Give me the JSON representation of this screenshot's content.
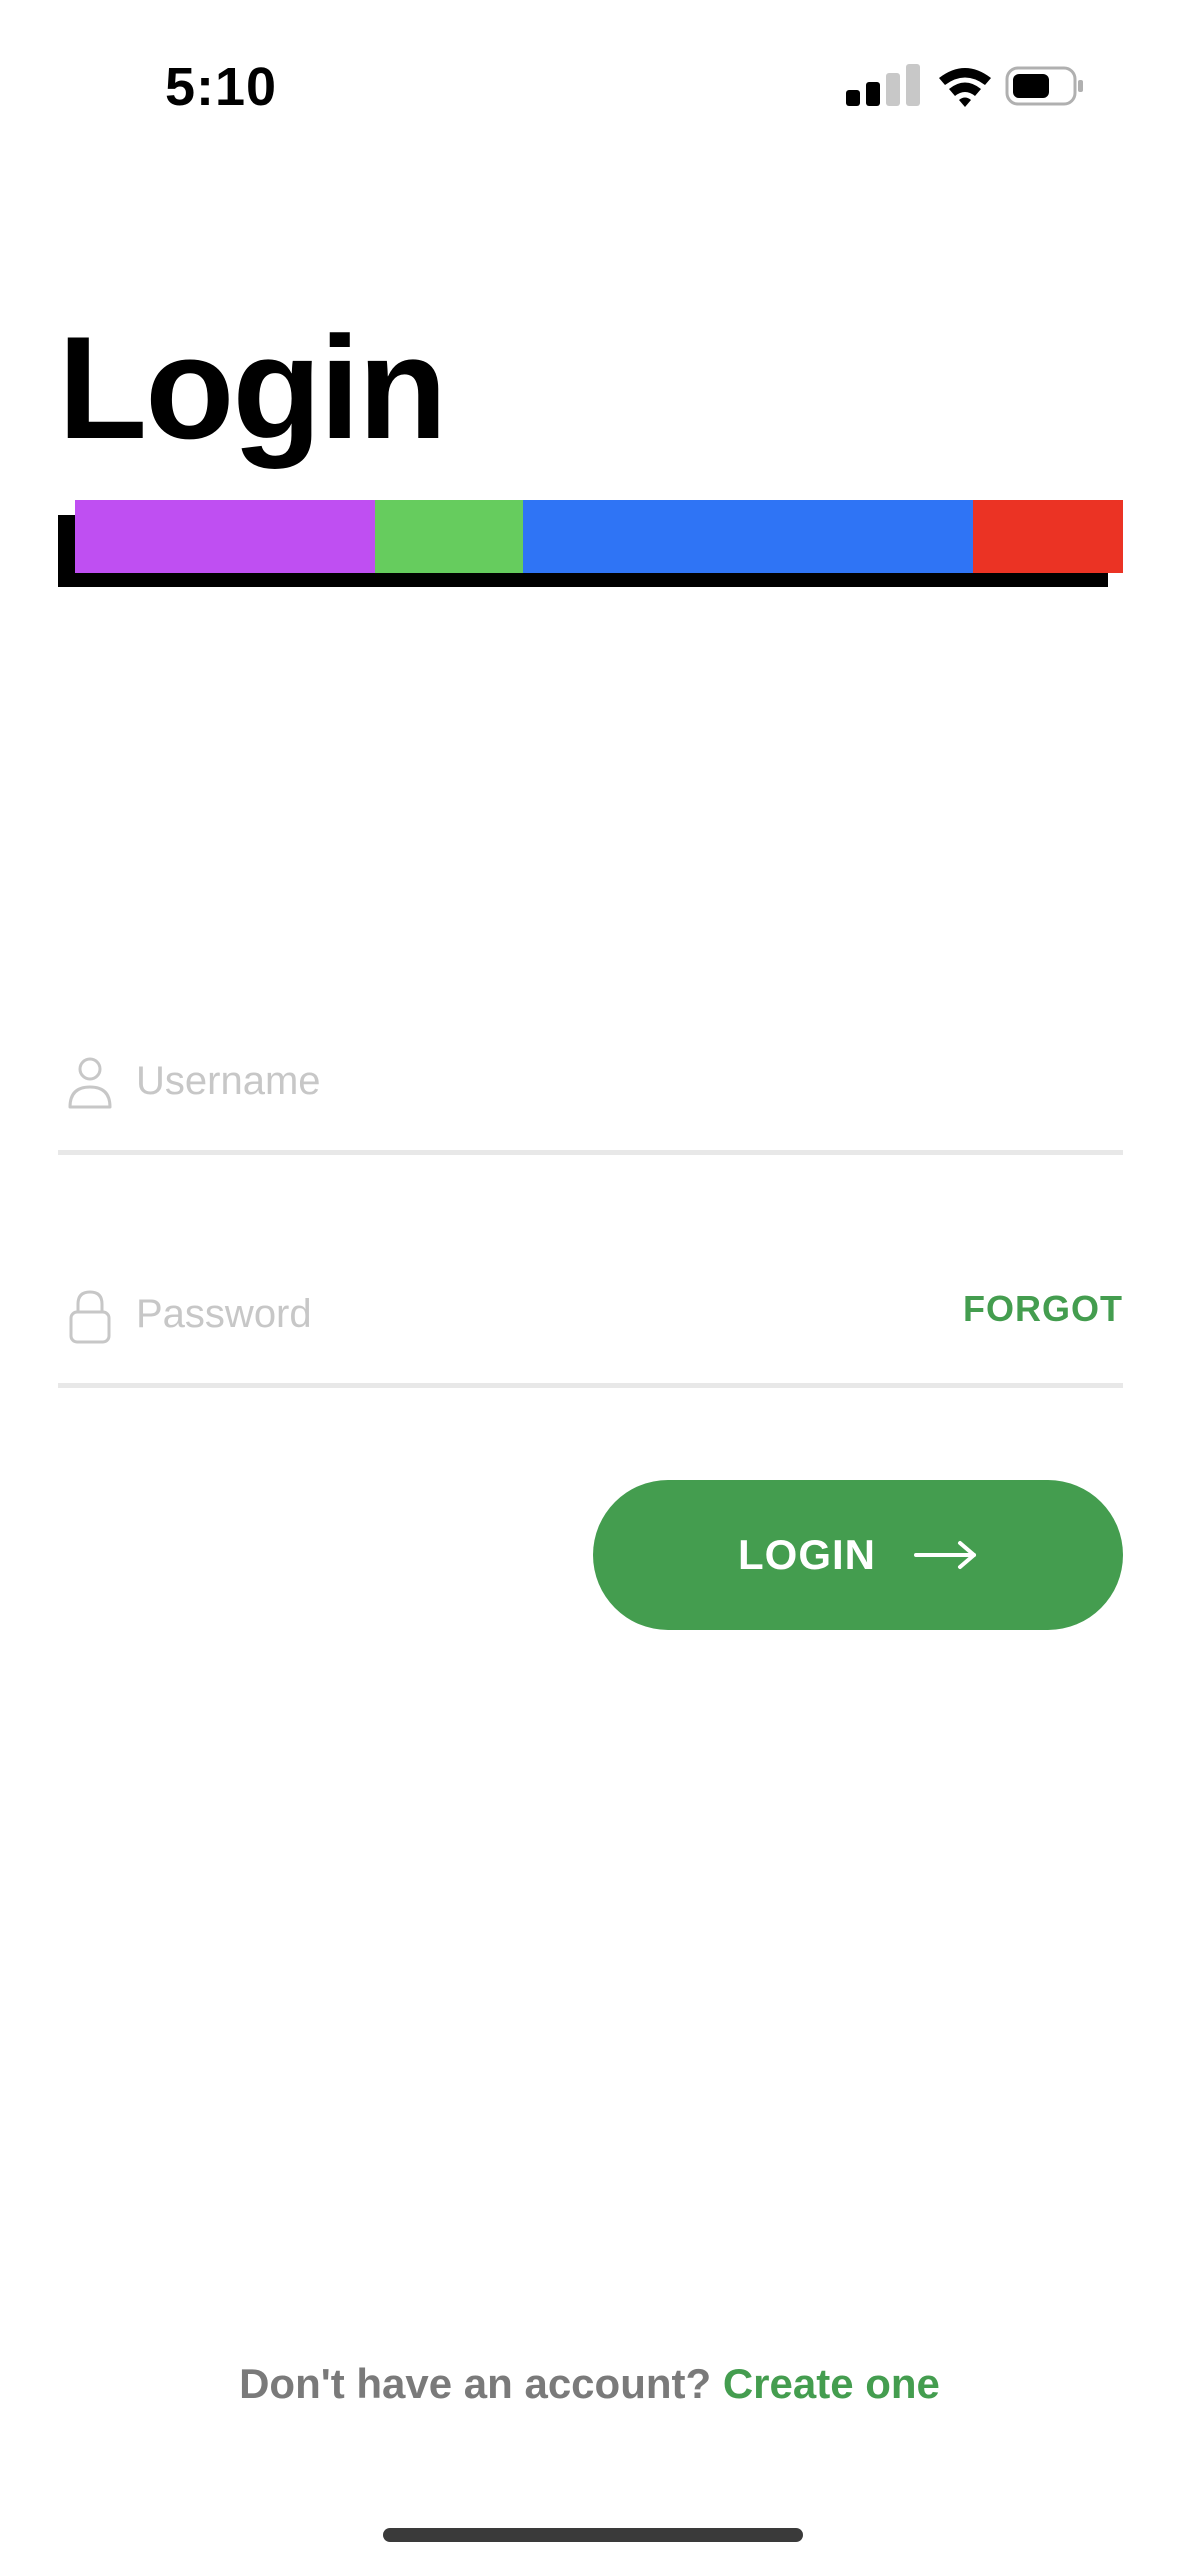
{
  "status_bar": {
    "time": "5:10",
    "icons": [
      "signal-icon",
      "wifi-icon",
      "battery-icon"
    ]
  },
  "page": {
    "title": "Login"
  },
  "color_bar": {
    "segments": [
      "#bf4ff2",
      "#66cc5e",
      "#2f74f5",
      "#eb3324"
    ],
    "shadow": "#000000"
  },
  "form": {
    "username": {
      "placeholder": "Username",
      "value": "",
      "icon": "user-icon"
    },
    "password": {
      "placeholder": "Password",
      "value": "",
      "icon": "lock-icon",
      "forgot_label": "FORGOT"
    },
    "login_button": {
      "label": "LOGIN",
      "icon": "arrow-right-icon"
    }
  },
  "footer": {
    "prompt": "Don't have an account?",
    "link": "Create one"
  },
  "colors": {
    "accent": "#449d4f",
    "placeholder": "#c7c7c7",
    "divider": "#e8e8e8",
    "muted_text": "#7a7a7a"
  }
}
